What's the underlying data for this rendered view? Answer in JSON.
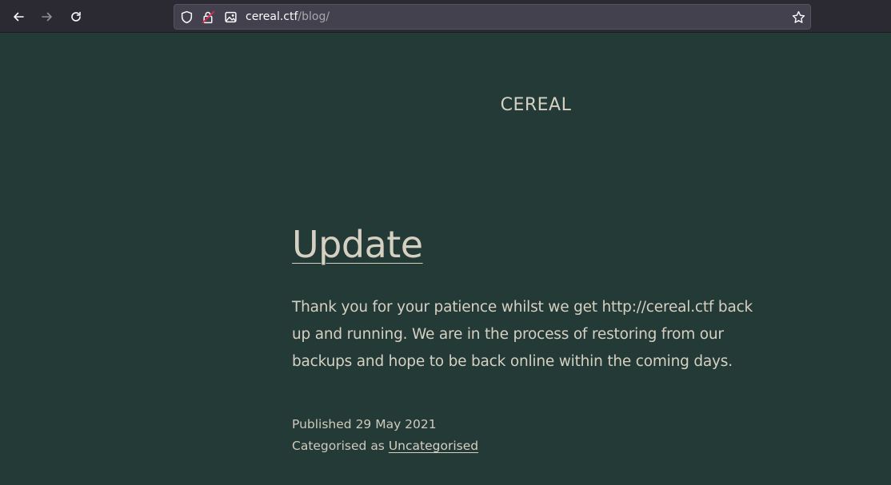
{
  "browser": {
    "url_host": "cereal.ctf",
    "url_path": "/blog/",
    "icons": {
      "back": "arrow-left-icon",
      "forward": "arrow-right-icon",
      "reload": "reload-icon",
      "tracking": "shield-icon",
      "lock": "lock-warning-icon",
      "permissions": "image-icon",
      "bookmark": "star-icon"
    },
    "colors": {
      "toolbar": "#2b2a33",
      "urlbar": "#42414d",
      "lock_warning": "#e22850"
    }
  },
  "site": {
    "title": "CEREAL",
    "background": "#233a36",
    "text_color": "#d6d0c2"
  },
  "post": {
    "title": "Update",
    "body": "Thank you for your patience whilst we get http://cereal.ctf back up and running. We are in the process of restoring from our backups and hope to be back online within the coming days.",
    "published_label": "Published",
    "published_date": "29 May 2021",
    "category_label": "Categorised as",
    "category": "Uncategorised"
  }
}
